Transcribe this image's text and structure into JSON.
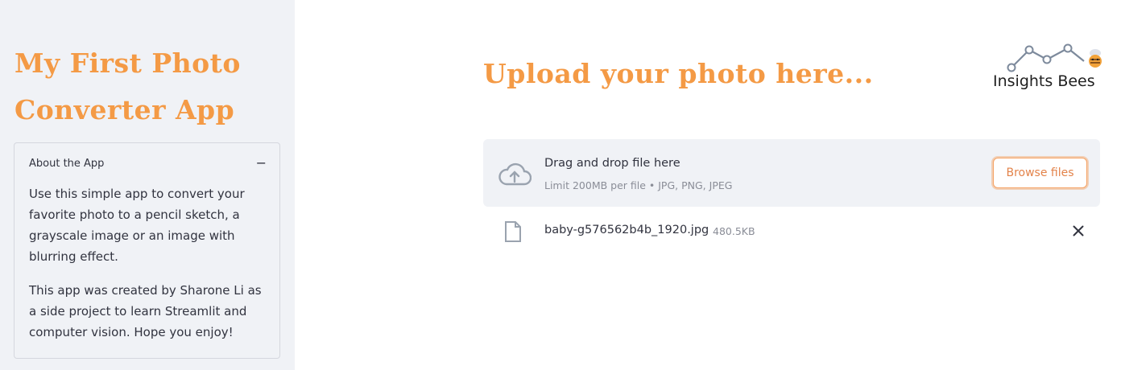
{
  "sidebar": {
    "title": "My First Photo Converter App",
    "about": {
      "header": "About the App",
      "toggle": "−",
      "paragraph_1": "Use this simple app to convert your favorite photo to a pencil sketch, a grayscale image or an image with blurring effect.",
      "paragraph_2": "This app was created by Sharone Li as a side project to learn Streamlit and computer vision. Hope you enjoy!"
    }
  },
  "main": {
    "heading": "Upload your photo here...",
    "brand": {
      "name": "Insights Bees",
      "icon": "insights-bees-logo"
    },
    "uploader": {
      "icon": "cloud-upload-icon",
      "title": "Drag and drop file here",
      "hint": "Limit 200MB per file • JPG, PNG, JPEG",
      "browse_label": "Browse files"
    },
    "file": {
      "icon": "file-icon",
      "name": "baby-g576562b4b_1920.jpg",
      "size": "480.5KB",
      "remove_icon": "close-icon"
    }
  },
  "colors": {
    "accent": "#f49a45",
    "sidebar_bg": "#f0f2f6",
    "text": "#31333f",
    "muted": "#8a8d97",
    "button_text": "#e3834a"
  }
}
